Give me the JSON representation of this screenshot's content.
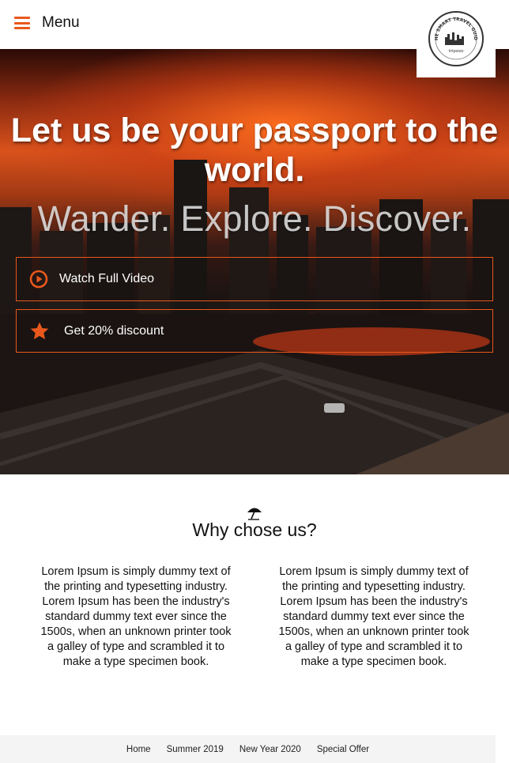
{
  "header": {
    "menu_label": "Menu",
    "logo_text_top": "THE SMART TRAVEL GUIDE",
    "logo_text_brand": "triposo",
    "accent_color": "#e8581c"
  },
  "hero": {
    "title": "Let us be your passport to the world.",
    "subtitle": "Wander. Explore. Discover.",
    "buttons": [
      {
        "label": "Watch Full Video",
        "icon": "play-circle-icon"
      },
      {
        "label": "Get 20% discount",
        "icon": "star-icon"
      }
    ]
  },
  "why": {
    "icon": "beach-umbrella-icon",
    "title": "Why chose us?",
    "columns": [
      "Lorem Ipsum is simply dummy text of the printing and typesetting industry. Lorem Ipsum has been the industry's standard dummy text ever since the 1500s, when an unknown printer took a galley of type and scrambled it to make a type specimen book.",
      "Lorem Ipsum is simply dummy text of the printing and typesetting industry. Lorem Ipsum has been the industry's standard dummy text ever since the 1500s, when an unknown printer took a galley of type and scrambled it to make a type specimen book."
    ]
  },
  "footer": {
    "links": [
      "Home",
      "Summer 2019",
      "New Year 2020",
      "Special Offer"
    ]
  }
}
